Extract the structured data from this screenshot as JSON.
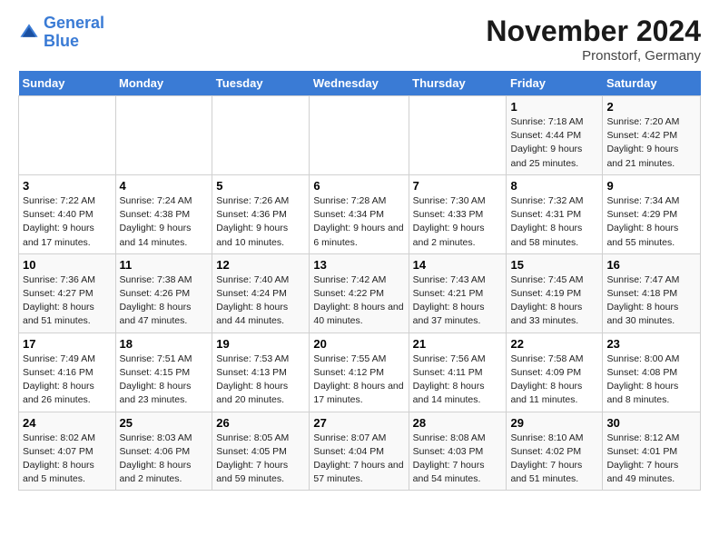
{
  "header": {
    "logo_line1": "General",
    "logo_line2": "Blue",
    "main_title": "November 2024",
    "subtitle": "Pronstorf, Germany"
  },
  "weekdays": [
    "Sunday",
    "Monday",
    "Tuesday",
    "Wednesday",
    "Thursday",
    "Friday",
    "Saturday"
  ],
  "weeks": [
    [
      {
        "day": "",
        "info": ""
      },
      {
        "day": "",
        "info": ""
      },
      {
        "day": "",
        "info": ""
      },
      {
        "day": "",
        "info": ""
      },
      {
        "day": "",
        "info": ""
      },
      {
        "day": "1",
        "info": "Sunrise: 7:18 AM\nSunset: 4:44 PM\nDaylight: 9 hours and 25 minutes."
      },
      {
        "day": "2",
        "info": "Sunrise: 7:20 AM\nSunset: 4:42 PM\nDaylight: 9 hours and 21 minutes."
      }
    ],
    [
      {
        "day": "3",
        "info": "Sunrise: 7:22 AM\nSunset: 4:40 PM\nDaylight: 9 hours and 17 minutes."
      },
      {
        "day": "4",
        "info": "Sunrise: 7:24 AM\nSunset: 4:38 PM\nDaylight: 9 hours and 14 minutes."
      },
      {
        "day": "5",
        "info": "Sunrise: 7:26 AM\nSunset: 4:36 PM\nDaylight: 9 hours and 10 minutes."
      },
      {
        "day": "6",
        "info": "Sunrise: 7:28 AM\nSunset: 4:34 PM\nDaylight: 9 hours and 6 minutes."
      },
      {
        "day": "7",
        "info": "Sunrise: 7:30 AM\nSunset: 4:33 PM\nDaylight: 9 hours and 2 minutes."
      },
      {
        "day": "8",
        "info": "Sunrise: 7:32 AM\nSunset: 4:31 PM\nDaylight: 8 hours and 58 minutes."
      },
      {
        "day": "9",
        "info": "Sunrise: 7:34 AM\nSunset: 4:29 PM\nDaylight: 8 hours and 55 minutes."
      }
    ],
    [
      {
        "day": "10",
        "info": "Sunrise: 7:36 AM\nSunset: 4:27 PM\nDaylight: 8 hours and 51 minutes."
      },
      {
        "day": "11",
        "info": "Sunrise: 7:38 AM\nSunset: 4:26 PM\nDaylight: 8 hours and 47 minutes."
      },
      {
        "day": "12",
        "info": "Sunrise: 7:40 AM\nSunset: 4:24 PM\nDaylight: 8 hours and 44 minutes."
      },
      {
        "day": "13",
        "info": "Sunrise: 7:42 AM\nSunset: 4:22 PM\nDaylight: 8 hours and 40 minutes."
      },
      {
        "day": "14",
        "info": "Sunrise: 7:43 AM\nSunset: 4:21 PM\nDaylight: 8 hours and 37 minutes."
      },
      {
        "day": "15",
        "info": "Sunrise: 7:45 AM\nSunset: 4:19 PM\nDaylight: 8 hours and 33 minutes."
      },
      {
        "day": "16",
        "info": "Sunrise: 7:47 AM\nSunset: 4:18 PM\nDaylight: 8 hours and 30 minutes."
      }
    ],
    [
      {
        "day": "17",
        "info": "Sunrise: 7:49 AM\nSunset: 4:16 PM\nDaylight: 8 hours and 26 minutes."
      },
      {
        "day": "18",
        "info": "Sunrise: 7:51 AM\nSunset: 4:15 PM\nDaylight: 8 hours and 23 minutes."
      },
      {
        "day": "19",
        "info": "Sunrise: 7:53 AM\nSunset: 4:13 PM\nDaylight: 8 hours and 20 minutes."
      },
      {
        "day": "20",
        "info": "Sunrise: 7:55 AM\nSunset: 4:12 PM\nDaylight: 8 hours and 17 minutes."
      },
      {
        "day": "21",
        "info": "Sunrise: 7:56 AM\nSunset: 4:11 PM\nDaylight: 8 hours and 14 minutes."
      },
      {
        "day": "22",
        "info": "Sunrise: 7:58 AM\nSunset: 4:09 PM\nDaylight: 8 hours and 11 minutes."
      },
      {
        "day": "23",
        "info": "Sunrise: 8:00 AM\nSunset: 4:08 PM\nDaylight: 8 hours and 8 minutes."
      }
    ],
    [
      {
        "day": "24",
        "info": "Sunrise: 8:02 AM\nSunset: 4:07 PM\nDaylight: 8 hours and 5 minutes."
      },
      {
        "day": "25",
        "info": "Sunrise: 8:03 AM\nSunset: 4:06 PM\nDaylight: 8 hours and 2 minutes."
      },
      {
        "day": "26",
        "info": "Sunrise: 8:05 AM\nSunset: 4:05 PM\nDaylight: 7 hours and 59 minutes."
      },
      {
        "day": "27",
        "info": "Sunrise: 8:07 AM\nSunset: 4:04 PM\nDaylight: 7 hours and 57 minutes."
      },
      {
        "day": "28",
        "info": "Sunrise: 8:08 AM\nSunset: 4:03 PM\nDaylight: 7 hours and 54 minutes."
      },
      {
        "day": "29",
        "info": "Sunrise: 8:10 AM\nSunset: 4:02 PM\nDaylight: 7 hours and 51 minutes."
      },
      {
        "day": "30",
        "info": "Sunrise: 8:12 AM\nSunset: 4:01 PM\nDaylight: 7 hours and 49 minutes."
      }
    ]
  ]
}
